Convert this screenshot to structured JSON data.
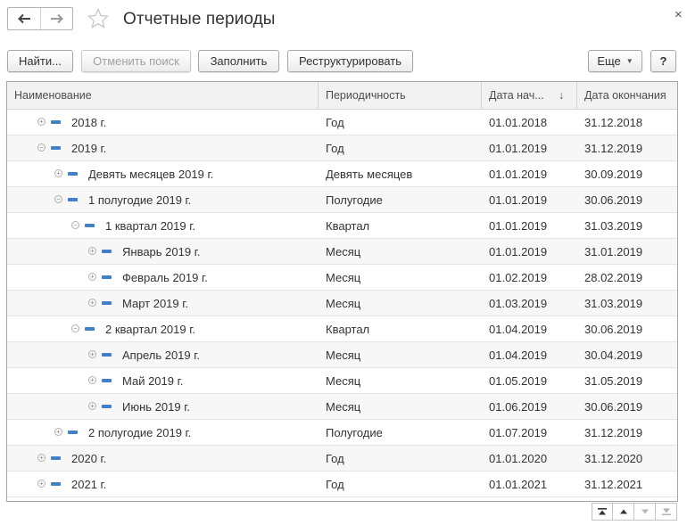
{
  "window": {
    "title": "Отчетные периоды",
    "close_symbol": "×",
    "icons": {
      "back": "arrow-left-icon",
      "forward": "arrow-right-icon",
      "favorite": "star-icon"
    }
  },
  "toolbar": {
    "find_label": "Найти...",
    "cancel_search_label": "Отменить поиск",
    "fill_label": "Заполнить",
    "restructure_label": "Реструктурировать",
    "more_label": "Еще",
    "help_label": "?"
  },
  "grid": {
    "columns": [
      "Наименование",
      "Периодичность",
      "Дата нач...",
      "Дата окончания"
    ],
    "sort_indicator": "↓",
    "rows": [
      {
        "name": "2018 г.",
        "periodicity": "Год",
        "start": "01.01.2018",
        "end": "31.12.2018",
        "expanded": false
      },
      {
        "name": "2019 г.",
        "periodicity": "Год",
        "start": "01.01.2019",
        "end": "31.12.2019",
        "expanded": true
      },
      {
        "name": "Девять месяцев 2019 г.",
        "periodicity": "Девять месяцев",
        "start": "01.01.2019",
        "end": "30.09.2019",
        "expanded": false
      },
      {
        "name": "1 полугодие 2019 г.",
        "periodicity": "Полугодие",
        "start": "01.01.2019",
        "end": "30.06.2019",
        "expanded": true
      },
      {
        "name": "1 квартал 2019 г.",
        "periodicity": "Квартал",
        "start": "01.01.2019",
        "end": "31.03.2019",
        "expanded": true
      },
      {
        "name": "Январь 2019 г.",
        "periodicity": "Месяц",
        "start": "01.01.2019",
        "end": "31.01.2019",
        "expanded": false
      },
      {
        "name": "Февраль 2019 г.",
        "periodicity": "Месяц",
        "start": "01.02.2019",
        "end": "28.02.2019",
        "expanded": false
      },
      {
        "name": "Март 2019 г.",
        "periodicity": "Месяц",
        "start": "01.03.2019",
        "end": "31.03.2019",
        "expanded": false
      },
      {
        "name": "2 квартал 2019 г.",
        "periodicity": "Квартал",
        "start": "01.04.2019",
        "end": "30.06.2019",
        "expanded": true
      },
      {
        "name": "Апрель 2019 г.",
        "periodicity": "Месяц",
        "start": "01.04.2019",
        "end": "30.04.2019",
        "expanded": false
      },
      {
        "name": "Май 2019 г.",
        "periodicity": "Месяц",
        "start": "01.05.2019",
        "end": "31.05.2019",
        "expanded": false
      },
      {
        "name": "Июнь 2019 г.",
        "periodicity": "Месяц",
        "start": "01.06.2019",
        "end": "30.06.2019",
        "expanded": false
      },
      {
        "name": "2 полугодие 2019 г.",
        "periodicity": "Полугодие",
        "start": "01.07.2019",
        "end": "31.12.2019",
        "expanded": false
      },
      {
        "name": "2020 г.",
        "periodicity": "Год",
        "start": "01.01.2020",
        "end": "31.12.2020",
        "expanded": false
      },
      {
        "name": "2021 г.",
        "periodicity": "Год",
        "start": "01.01.2021",
        "end": "31.12.2021",
        "expanded": false
      }
    ]
  },
  "pager": {
    "icons": [
      "first-page-icon",
      "previous-page-icon",
      "next-page-icon",
      "last-page-icon"
    ]
  },
  "colors": {
    "accent": "#3f80c8",
    "border": "#a5a5a5",
    "header_bg": "#f2f2f2"
  }
}
